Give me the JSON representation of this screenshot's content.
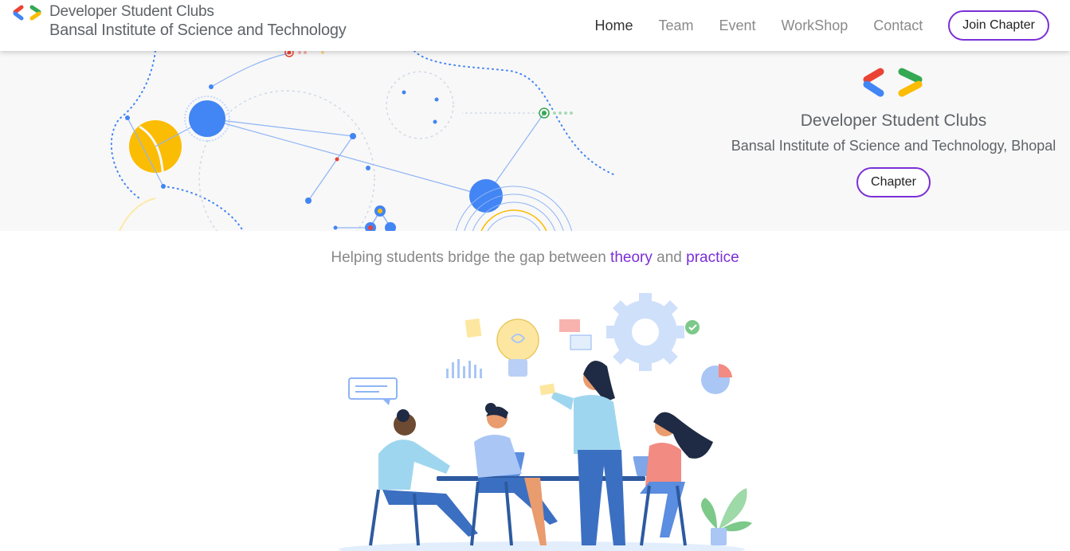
{
  "header": {
    "brand_title": "Developer Student Clubs",
    "brand_subtitle": "Bansal Institute of Science and Technology",
    "logo_icon": "dsc-brackets-icon",
    "nav": [
      {
        "label": "Home",
        "active": true
      },
      {
        "label": "Team",
        "active": false
      },
      {
        "label": "Event",
        "active": false
      },
      {
        "label": "WorkShop",
        "active": false
      },
      {
        "label": "Contact",
        "active": false
      }
    ],
    "join_label": "Join Chapter"
  },
  "hero": {
    "title": "Developer Student Clubs",
    "subtitle": "Bansal Institute of Science and Technology, Bhopal",
    "button_label": "Chapter"
  },
  "tagline": {
    "prefix": "Helping students bridge the gap between ",
    "word1": "theory",
    "middle": " and ",
    "word2": "practice"
  },
  "colors": {
    "accent": "#7b2fd6",
    "google_blue": "#4285f4",
    "google_red": "#ea4335",
    "google_yellow": "#fbbc04",
    "google_green": "#34a853"
  }
}
